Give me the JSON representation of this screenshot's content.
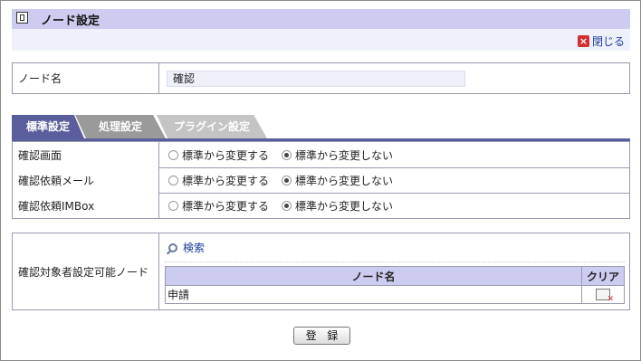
{
  "header": {
    "title": "ノード設定",
    "close_label": "閉じる"
  },
  "node": {
    "label": "ノード名",
    "value": "確認"
  },
  "tabs": [
    {
      "label": "標準設定",
      "active": true
    },
    {
      "label": "処理設定",
      "active": false
    },
    {
      "label": "プラグイン設定",
      "active": false
    }
  ],
  "settings": [
    {
      "label": "確認画面",
      "option_a": "標準から変更する",
      "option_b": "標準から変更しない",
      "selected": "option_b"
    },
    {
      "label": "確認依頼メール",
      "option_a": "標準から変更する",
      "option_b": "標準から変更しない",
      "selected": "option_b"
    },
    {
      "label": "確認依頼IMBox",
      "option_a": "標準から変更する",
      "option_b": "標準から変更しない",
      "selected": "option_b"
    }
  ],
  "target": {
    "label": "確認対象者設定可能ノード",
    "search_label": "検索",
    "columns": [
      "ノード名",
      "クリア"
    ],
    "rows": [
      {
        "name": "申請"
      }
    ]
  },
  "submit_label": "登 録",
  "colors": {
    "accent": "#5b5e9c",
    "header_bg": "#ccccf0",
    "link": "#1a3c9c"
  }
}
